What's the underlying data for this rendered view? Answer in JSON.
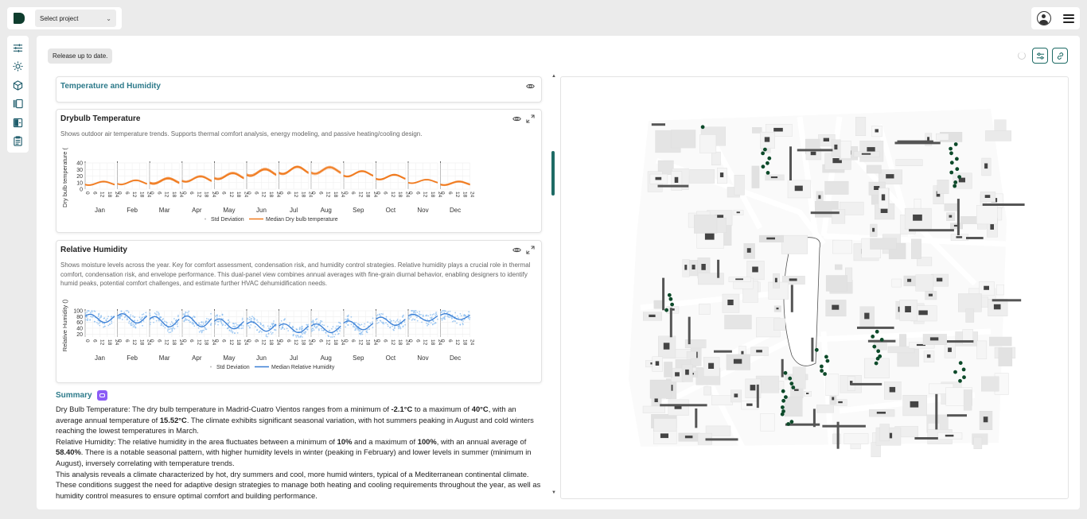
{
  "topbar": {
    "project_select": "Select project"
  },
  "sidebar": {
    "items": [
      {
        "name": "sliders-icon"
      },
      {
        "name": "sun-icon"
      },
      {
        "name": "cube-icon"
      },
      {
        "name": "panels-icon"
      },
      {
        "name": "layout-icon"
      },
      {
        "name": "clipboard-icon"
      }
    ]
  },
  "main": {
    "release_status": "Release up to date."
  },
  "section": {
    "title": "Temperature and Humidity"
  },
  "drybulb": {
    "title": "Drybulb Temperature",
    "description": "Shows outdoor air temperature trends. Supports thermal comfort analysis, energy modeling, and passive heating/cooling design.",
    "ylabel": "Dry bulb temperature (",
    "legend_std": "Std Deviation",
    "legend_median": "Median Dry bulb temperature",
    "color": "#f07a1e"
  },
  "humidity": {
    "title": "Relative Humidity",
    "description": "Shows moisture levels across the year. Key for comfort assessment, condensation risk, and humidity control strategies. Relative humidity plays a crucial role in thermal comfort, condensation risk, and envelope performance. This dual-panel view combines annual averages with fine-grain diurnal behavior, enabling designers to identify humid peaks, potential comfort challenges, and estimate further HVAC dehumidification needs.",
    "ylabel": "Relative Humidity ()",
    "legend_std": "Std Deviation",
    "legend_median": "Median Relative Humidity",
    "color": "#3a7fd5"
  },
  "chart_data": [
    {
      "type": "line",
      "title": "Drybulb Temperature",
      "ylabel": "Dry bulb temperature (",
      "categories": [
        "Jan",
        "Feb",
        "Mar",
        "Apr",
        "May",
        "Jun",
        "Jul",
        "Aug",
        "Sep",
        "Oct",
        "Nov",
        "Dec"
      ],
      "hour_ticks": [
        "0",
        "6",
        "12",
        "18",
        "24"
      ],
      "ylim": [
        0,
        40
      ],
      "yticks": [
        "0",
        "10",
        "20",
        "30",
        "40"
      ],
      "series": [
        {
          "name": "Median Dry bulb temperature",
          "monthly_min": [
            6,
            7,
            8,
            11,
            15,
            20,
            23,
            23,
            19,
            14,
            9,
            6
          ],
          "monthly_max": [
            12,
            14,
            17,
            20,
            25,
            31,
            35,
            34,
            28,
            22,
            15,
            12
          ]
        }
      ],
      "legend": [
        "Std Deviation",
        "Median Dry bulb temperature"
      ],
      "legend_placement": "bottom",
      "grid": true
    },
    {
      "type": "scatter",
      "title": "Relative Humidity",
      "ylabel": "Relative Humidity ()",
      "categories": [
        "Jan",
        "Feb",
        "Mar",
        "Apr",
        "May",
        "Jun",
        "Jul",
        "Aug",
        "Sep",
        "Oct",
        "Nov",
        "Dec"
      ],
      "hour_ticks": [
        "0",
        "6",
        "12",
        "18",
        "24"
      ],
      "ylim": [
        10,
        100
      ],
      "yticks": [
        "20",
        "40",
        "60",
        "80",
        "100"
      ],
      "series": [
        {
          "name": "Median Relative Humidity",
          "monthly_max": [
            88,
            90,
            80,
            82,
            72,
            62,
            55,
            55,
            65,
            78,
            88,
            90
          ],
          "monthly_min": [
            60,
            58,
            45,
            45,
            38,
            30,
            25,
            25,
            35,
            50,
            65,
            70
          ]
        }
      ],
      "legend": [
        "Std Deviation",
        "Median Relative Humidity"
      ],
      "legend_placement": "bottom",
      "grid": true
    }
  ],
  "summary": {
    "title": "Summary",
    "p1_a": "Dry Bulb Temperature: The dry bulb temperature in Madrid-Cuatro Vientos ranges from a minimum of ",
    "p1_min": "-2.1°C",
    "p1_b": " to a maximum of ",
    "p1_max": "40°C",
    "p1_c": ", with an average annual temperature of ",
    "p1_avg": "15.52°C",
    "p1_d": ". The climate exhibits significant seasonal variation, with hot summers peaking in August and cold winters reaching the lowest temperatures in March.",
    "p2_a": "Relative Humidity: The relative humidity in the area fluctuates between a minimum of ",
    "p2_min": "10%",
    "p2_b": " and a maximum of ",
    "p2_max": "100%",
    "p2_c": ", with an annual average of ",
    "p2_avg": "58.40%",
    "p2_d": ". There is a notable seasonal pattern, with higher humidity levels in winter (peaking in February) and lower levels in summer (minimum in August), inversely correlating with temperature trends.",
    "p3": "This analysis reveals a climate characterized by hot, dry summers and cool, more humid winters, typical of a Mediterranean continental climate. These conditions suggest the need for adaptive design strategies to manage both heating and cooling requirements throughout the year, as well as humidity control measures to ensure optimal comfort and building performance."
  },
  "colors": {
    "accent": "#1e6b65",
    "section_title": "#2d7a8a",
    "ai_badge": "#8b5cf6",
    "tree": "#0d4a2a"
  }
}
